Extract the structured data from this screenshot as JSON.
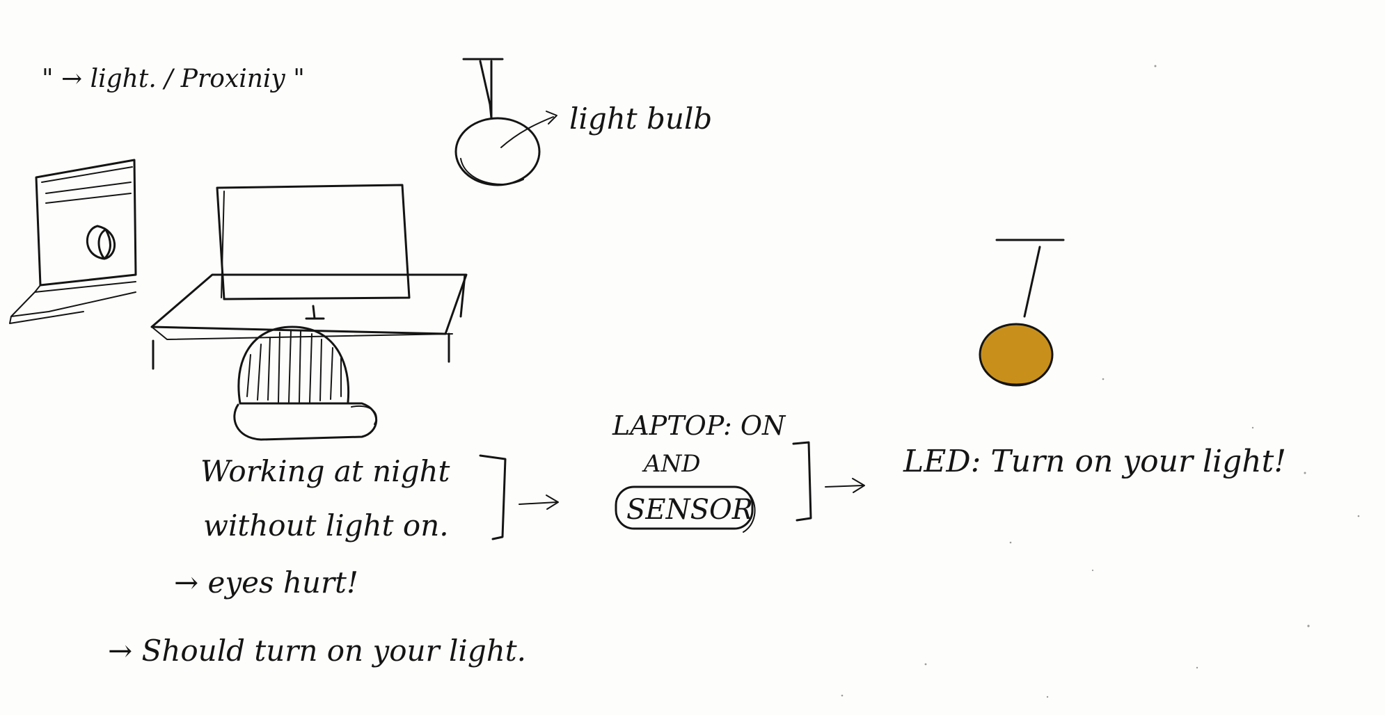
{
  "header_note": "\" → light. / Proxiniy \"",
  "bulb_label": "light bulb",
  "scene": {
    "laptop": "laptop-sketch",
    "window": "night-window-sketch",
    "person": "person-at-desk-sketch"
  },
  "problem": {
    "line1": "Working at night",
    "line2": "without light on.",
    "consequence": "→ eyes hurt!",
    "suggestion": "→ Should turn on your light."
  },
  "condition": {
    "line1": "LAPTOP: ON",
    "line2": "AND",
    "line3": "SENSOR"
  },
  "output": {
    "text": "LED: Turn on your light!",
    "led_color": "#c8901a"
  },
  "arrow_glyph": "→"
}
